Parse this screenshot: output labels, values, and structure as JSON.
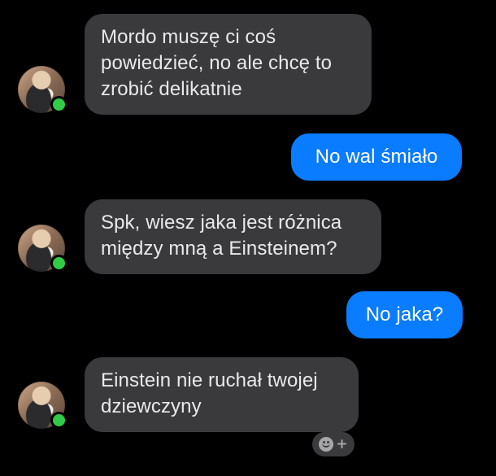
{
  "conversation": {
    "messages": [
      {
        "sender": "other",
        "lines": [
          "Mordo muszę ci coś",
          "powiedzieć, no ale chcę to",
          "zrobić delikatnie"
        ]
      },
      {
        "sender": "me",
        "lines": [
          "No wal śmiało"
        ]
      },
      {
        "sender": "other",
        "lines": [
          "Spk, wiesz jaka jest różnica",
          "między mną a Einsteinem?"
        ]
      },
      {
        "sender": "me",
        "lines": [
          "No jaka?"
        ]
      },
      {
        "sender": "other",
        "lines": [
          "Einstein nie ruchał twojej",
          "dziewczyny"
        ]
      }
    ],
    "react_button": {
      "icon": "add-reaction-icon",
      "symbol": "+"
    }
  },
  "colors": {
    "background": "#000000",
    "received_bubble": "#3a3a3c",
    "received_text": "#e9e9ea",
    "sent_bubble": "#0a7cff",
    "sent_text": "#ffffff",
    "online_indicator": "#31cc46"
  }
}
